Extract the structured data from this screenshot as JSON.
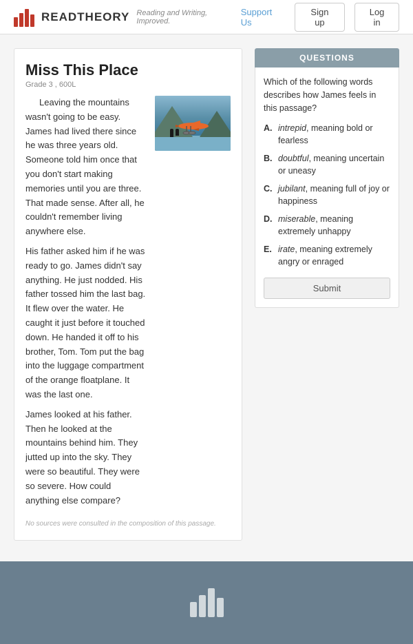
{
  "header": {
    "logo_text": "READTHEORY",
    "logo_tagline": "Reading and Writing, Improved.",
    "support_link": "Support Us",
    "signup_btn": "Sign up",
    "login_btn": "Log in"
  },
  "article": {
    "title": "Miss This Place",
    "meta": "Grade 3 , 600L",
    "body_paragraphs": [
      "Leaving the mountains wasn't going to be easy. James had lived there since he was three years old. Someone told him once that you don't start making memories until you are three. That made sense. After all, he couldn't remember living anywhere else.",
      "His father asked him if he was ready to go. James didn't say anything. He just nodded. His father tossed him the last bag. It flew over the water. He caught it just before it touched down. He handed it off to his brother, Tom. Tom put the bag into the luggage compartment of the orange floatplane. It was the last one.",
      "James looked at his father. Then he looked at the mountains behind him. They jutted up into the sky. They were so beautiful. They were so severe. How could anything else compare?"
    ],
    "footer_note": "No sources were consulted in the composition of this passage."
  },
  "questions": {
    "header": "QUESTIONS",
    "prompt": "Which of the following words describes how James feels in this passage?",
    "options": [
      {
        "letter": "A.",
        "italic": "intrepid",
        "text": ", meaning bold or fearless"
      },
      {
        "letter": "B.",
        "italic": "doubtful",
        "text": ", meaning uncertain or uneasy"
      },
      {
        "letter": "C.",
        "italic": "jubilant",
        "text": ", meaning full of joy or happiness"
      },
      {
        "letter": "D.",
        "italic": "miserable",
        "text": ", meaning extremely unhappy"
      },
      {
        "letter": "E.",
        "italic": "irate",
        "text": ", meaning extremely angry or enraged"
      }
    ],
    "submit_btn": "Submit"
  }
}
